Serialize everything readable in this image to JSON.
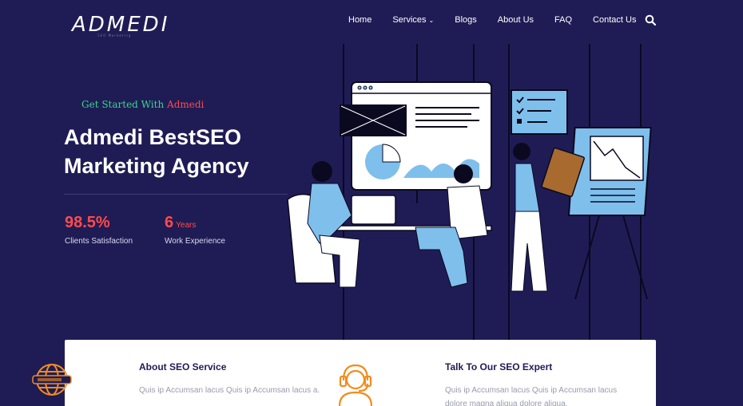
{
  "header": {
    "logo_text": "ADMEDI",
    "logo_tagline": "SEO Marketing",
    "nav": [
      {
        "label": "Home"
      },
      {
        "label": "Services",
        "has_dropdown": true
      },
      {
        "label": "Blogs"
      },
      {
        "label": "About Us"
      },
      {
        "label": "FAQ"
      },
      {
        "label": "Contact Us"
      }
    ],
    "search_icon": "search-icon"
  },
  "hero": {
    "eyebrow_prefix": "Get Started With",
    "eyebrow_brand": "Admedi",
    "title_line1": "Admedi BestSEO",
    "title_line2": "Marketing Agency",
    "stats": [
      {
        "value": "98.5%",
        "unit": "",
        "label": "Clients Satisfaction"
      },
      {
        "value": "6",
        "unit": "Years",
        "label": "Work Experience"
      }
    ]
  },
  "services": [
    {
      "title": "About SEO Service",
      "text": "Quis ip Accumsan lacus Quis ip Accumsan lacus a.",
      "icon": "globe-icon"
    },
    {
      "title": "Talk To Our SEO Expert",
      "text": "Quis ip Accumsan lacus Quis ip Accumsan lacus dolore magna aliqua dolore aliqua.",
      "icon": "support-agent-icon"
    }
  ],
  "colors": {
    "background": "#1f1c55",
    "accent_red": "#ff4b4b",
    "accent_green": "#38d68a",
    "illustration_blue": "#7fbfec",
    "icon_orange": "#f28c1e"
  }
}
